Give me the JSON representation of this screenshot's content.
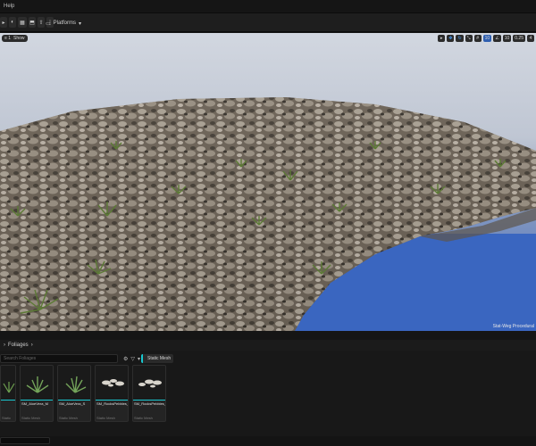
{
  "menubar": {
    "help_label": "Help"
  },
  "toolbar": {
    "platforms_label": "Platforms",
    "buttons": [
      "save-button",
      "mode-button",
      "content-button",
      "blueprint-button",
      "cinematics-button",
      "more-button"
    ]
  },
  "viewport": {
    "left_chip_label": "",
    "view_mode_label": "Show",
    "caption": "Stat-Weg Procedural",
    "tools": [
      "",
      "",
      "",
      "10",
      "",
      "10",
      "",
      "0.25",
      "4"
    ]
  },
  "panel": {
    "tab_label": "Foliages",
    "search_placeholder": "Search Foliages",
    "filter_chip_label": "Static Mesh",
    "assets": [
      {
        "name": "",
        "type": "Static Mesh"
      },
      {
        "name": "SM_AloeVera_M",
        "type": "Static Mesh"
      },
      {
        "name": "SM_AloeVera_S",
        "type": "Static Mesh"
      },
      {
        "name": "SM_RocksPebbles_01",
        "type": "Static Mesh"
      },
      {
        "name": "SM_RocksPebbles_02",
        "type": "Static Mesh"
      }
    ]
  },
  "colors": {
    "accent": "#18C8D0",
    "water": "#3B67C0",
    "sky": "#C4CAD6",
    "terrain": "#6D6255"
  }
}
